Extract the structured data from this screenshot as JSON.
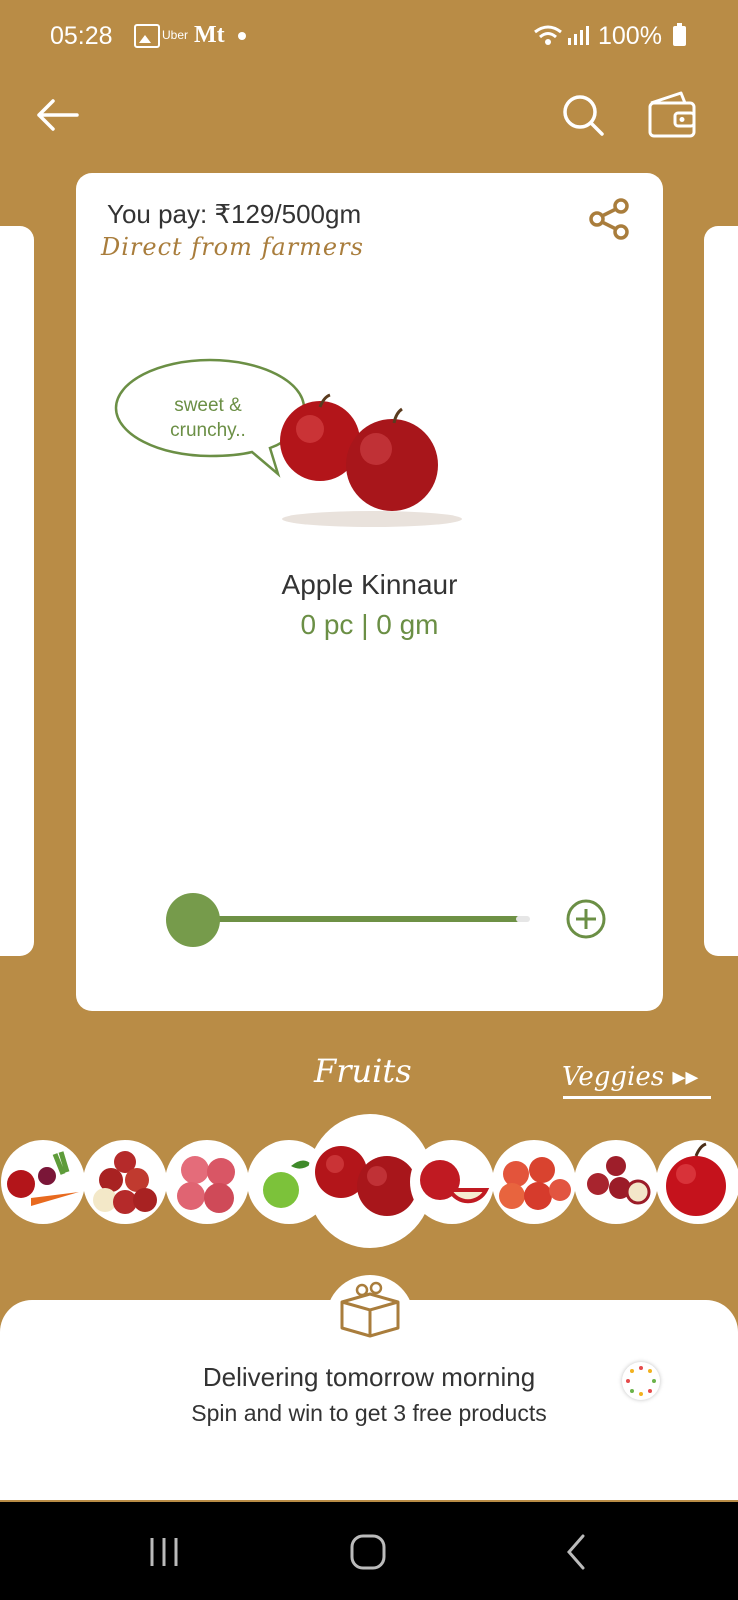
{
  "status_bar": {
    "time": "05:28",
    "uber_label": "Uber",
    "me_label": "Mt",
    "battery": "100%"
  },
  "topbar": {
    "icons": [
      "back-arrow-icon",
      "search-icon",
      "wallet-icon"
    ]
  },
  "product_card": {
    "price": "You pay: ₹129/500gm",
    "tagline": "Direct from farmers",
    "bubble_line1": "sweet &",
    "bubble_line2": "crunchy..",
    "name": "Apple Kinnaur",
    "quantity": "0 pc | 0 gm",
    "slider_value": 0
  },
  "categories": {
    "active": "Fruits",
    "next": "Veggies ▸▸"
  },
  "carousel": {
    "items": [
      "mixed-fruits-veggies",
      "apples-pile",
      "pink-apples",
      "green-apple",
      "apple-kinnaur",
      "apple-cut",
      "red-apples",
      "small-apples",
      "big-red-apple"
    ],
    "selected_index": 4
  },
  "bottom": {
    "delivery": "Delivering tomorrow morning",
    "promo": "Spin and win to get 3 free products"
  },
  "colors": {
    "background": "#b98c46",
    "accent_green": "#6b8f45",
    "accent_brown": "#a97d3c"
  }
}
